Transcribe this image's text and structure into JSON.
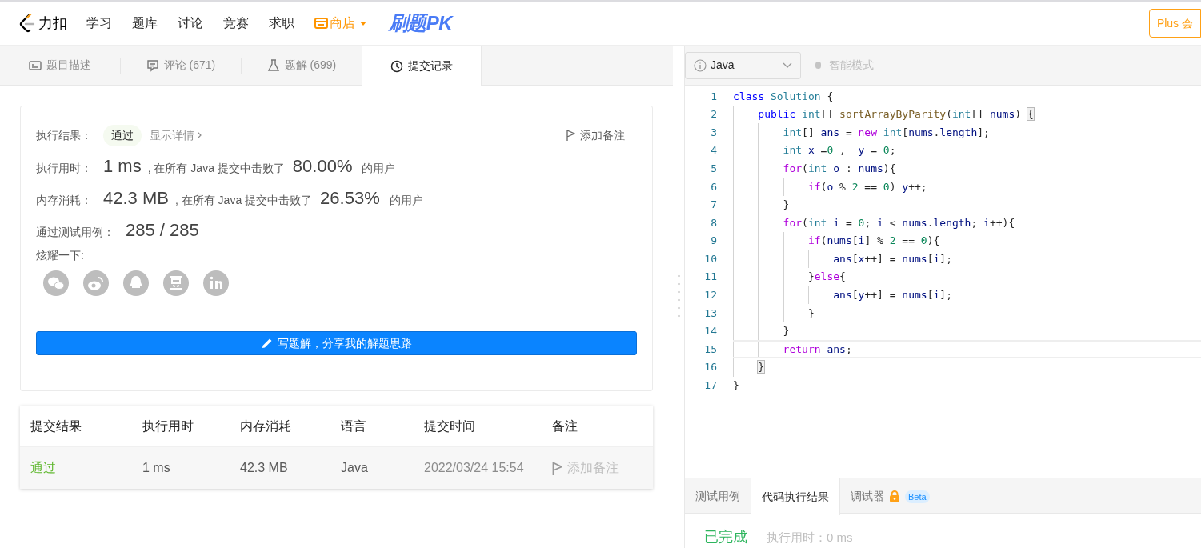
{
  "nav": {
    "logo_text": "力扣",
    "items": [
      {
        "label": "学习",
        "kind": "link"
      },
      {
        "label": "题库",
        "kind": "link"
      },
      {
        "label": "讨论",
        "kind": "link"
      },
      {
        "label": "竞赛",
        "kind": "link"
      },
      {
        "label": "求职",
        "kind": "link"
      },
      {
        "label": "商店",
        "kind": "store"
      }
    ],
    "promo": "刷题PK",
    "plus_button": "Plus 会"
  },
  "tabs": [
    {
      "label": "题目描述",
      "kind": "description",
      "selected": false
    },
    {
      "label": "评论",
      "count": "(671)",
      "kind": "comments",
      "selected": false
    },
    {
      "label": "题解",
      "count": "(699)",
      "kind": "solutions",
      "selected": false
    },
    {
      "label": "提交记录",
      "kind": "submissions",
      "selected": true
    }
  ],
  "result": {
    "status_label": "执行结果：",
    "status": "通过",
    "details_link": "显示详情",
    "note_button": "添加备注",
    "runtime": {
      "label": "执行用时：",
      "value": "1 ms",
      "middle": ", 在所有 Java 提交中击败了",
      "percent": "80.00%",
      "suffix": "的用户"
    },
    "memory": {
      "label": "内存消耗：",
      "value": "42.3 MB",
      "middle": ", 在所有 Java 提交中击败了",
      "percent": "26.53%",
      "suffix": "的用户"
    },
    "tests": {
      "label": "通过测试用例：",
      "value": "285 / 285"
    },
    "share_label": "炫耀一下:",
    "share": [
      {
        "kind": "wechat"
      },
      {
        "kind": "weibo"
      },
      {
        "kind": "qq"
      },
      {
        "kind": "douban"
      },
      {
        "kind": "linkedin"
      }
    ],
    "write_button": "写题解，分享我的解题思路"
  },
  "table": {
    "columns": [
      "提交结果",
      "执行用时",
      "内存消耗",
      "语言",
      "提交时间",
      "备注"
    ],
    "rows": [
      {
        "status": "通过",
        "runtime": "1 ms",
        "memory": "42.3 MB",
        "language": "Java",
        "time": "2022/03/24 15:54",
        "note": "添加备注"
      }
    ]
  },
  "editor": {
    "language": "Java",
    "smart_mode": "智能模式",
    "smart_mode_on": false,
    "lines": [
      {
        "number": "1",
        "current": false,
        "tokens": [
          {
            "text": "class",
            "kind": "kw"
          },
          {
            "text": " Solution",
            "kind": "type"
          },
          {
            "text": " {",
            "kind": "plain"
          }
        ]
      },
      {
        "number": "2",
        "current": false,
        "tokens": [
          {
            "text": "    public",
            "kind": "kw"
          },
          {
            "text": " int",
            "kind": "type"
          },
          {
            "text": "[] ",
            "kind": "plain"
          },
          {
            "text": "sortArrayByParity",
            "kind": "fn"
          },
          {
            "text": "(",
            "kind": "plain"
          },
          {
            "text": "int",
            "kind": "type"
          },
          {
            "text": "[] ",
            "kind": "plain"
          },
          {
            "text": "nums",
            "kind": "var"
          },
          {
            "text": ") ",
            "kind": "plain"
          },
          {
            "text": "{",
            "kind": "match"
          }
        ]
      },
      {
        "number": "3",
        "current": false,
        "tokens": [
          {
            "text": "        int",
            "kind": "type"
          },
          {
            "text": "[] ",
            "kind": "plain"
          },
          {
            "text": "ans",
            "kind": "var"
          },
          {
            "text": " = ",
            "kind": "plain"
          },
          {
            "text": "new",
            "kind": "ctl"
          },
          {
            "text": " int",
            "kind": "type"
          },
          {
            "text": "[",
            "kind": "plain"
          },
          {
            "text": "nums",
            "kind": "var"
          },
          {
            "text": ".",
            "kind": "plain"
          },
          {
            "text": "length",
            "kind": "var"
          },
          {
            "text": "];",
            "kind": "plain"
          }
        ]
      },
      {
        "number": "4",
        "current": false,
        "tokens": [
          {
            "text": "        int",
            "kind": "type"
          },
          {
            "text": " x",
            "kind": "var"
          },
          {
            "text": " =",
            "kind": "plain"
          },
          {
            "text": "0",
            "kind": "num"
          },
          {
            "text": " ,  ",
            "kind": "plain"
          },
          {
            "text": "y",
            "kind": "var"
          },
          {
            "text": " = ",
            "kind": "plain"
          },
          {
            "text": "0",
            "kind": "num"
          },
          {
            "text": ";",
            "kind": "plain"
          }
        ]
      },
      {
        "number": "5",
        "current": false,
        "tokens": [
          {
            "text": "        for",
            "kind": "ctl"
          },
          {
            "text": "(",
            "kind": "plain"
          },
          {
            "text": "int",
            "kind": "type"
          },
          {
            "text": " o",
            "kind": "var"
          },
          {
            "text": " : ",
            "kind": "plain"
          },
          {
            "text": "nums",
            "kind": "var"
          },
          {
            "text": "){",
            "kind": "plain"
          }
        ]
      },
      {
        "number": "6",
        "current": false,
        "tokens": [
          {
            "text": "            if",
            "kind": "ctl"
          },
          {
            "text": "(",
            "kind": "plain"
          },
          {
            "text": "o",
            "kind": "var"
          },
          {
            "text": " % ",
            "kind": "plain"
          },
          {
            "text": "2",
            "kind": "num"
          },
          {
            "text": " == ",
            "kind": "plain"
          },
          {
            "text": "0",
            "kind": "num"
          },
          {
            "text": ") ",
            "kind": "plain"
          },
          {
            "text": "y",
            "kind": "var"
          },
          {
            "text": "++;",
            "kind": "plain"
          }
        ]
      },
      {
        "number": "7",
        "current": false,
        "tokens": [
          {
            "text": "        }",
            "kind": "plain"
          }
        ]
      },
      {
        "number": "8",
        "current": false,
        "tokens": [
          {
            "text": "        for",
            "kind": "ctl"
          },
          {
            "text": "(",
            "kind": "plain"
          },
          {
            "text": "int",
            "kind": "type"
          },
          {
            "text": " i",
            "kind": "var"
          },
          {
            "text": " = ",
            "kind": "plain"
          },
          {
            "text": "0",
            "kind": "num"
          },
          {
            "text": "; ",
            "kind": "plain"
          },
          {
            "text": "i",
            "kind": "var"
          },
          {
            "text": " < ",
            "kind": "plain"
          },
          {
            "text": "nums",
            "kind": "var"
          },
          {
            "text": ".",
            "kind": "plain"
          },
          {
            "text": "length",
            "kind": "var"
          },
          {
            "text": "; ",
            "kind": "plain"
          },
          {
            "text": "i",
            "kind": "var"
          },
          {
            "text": "++){",
            "kind": "plain"
          }
        ]
      },
      {
        "number": "9",
        "current": false,
        "tokens": [
          {
            "text": "            if",
            "kind": "ctl"
          },
          {
            "text": "(",
            "kind": "plain"
          },
          {
            "text": "nums",
            "kind": "var"
          },
          {
            "text": "[",
            "kind": "plain"
          },
          {
            "text": "i",
            "kind": "var"
          },
          {
            "text": "] % ",
            "kind": "plain"
          },
          {
            "text": "2",
            "kind": "num"
          },
          {
            "text": " == ",
            "kind": "plain"
          },
          {
            "text": "0",
            "kind": "num"
          },
          {
            "text": "){",
            "kind": "plain"
          }
        ]
      },
      {
        "number": "10",
        "current": false,
        "tokens": [
          {
            "text": "                ans",
            "kind": "var"
          },
          {
            "text": "[",
            "kind": "plain"
          },
          {
            "text": "x",
            "kind": "var"
          },
          {
            "text": "++] = ",
            "kind": "plain"
          },
          {
            "text": "nums",
            "kind": "var"
          },
          {
            "text": "[",
            "kind": "plain"
          },
          {
            "text": "i",
            "kind": "var"
          },
          {
            "text": "];",
            "kind": "plain"
          }
        ]
      },
      {
        "number": "11",
        "current": false,
        "tokens": [
          {
            "text": "            }",
            "kind": "plain"
          },
          {
            "text": "else",
            "kind": "ctl"
          },
          {
            "text": "{",
            "kind": "plain"
          }
        ]
      },
      {
        "number": "12",
        "current": false,
        "tokens": [
          {
            "text": "                ans",
            "kind": "var"
          },
          {
            "text": "[",
            "kind": "plain"
          },
          {
            "text": "y",
            "kind": "var"
          },
          {
            "text": "++] = ",
            "kind": "plain"
          },
          {
            "text": "nums",
            "kind": "var"
          },
          {
            "text": "[",
            "kind": "plain"
          },
          {
            "text": "i",
            "kind": "var"
          },
          {
            "text": "];",
            "kind": "plain"
          }
        ]
      },
      {
        "number": "13",
        "current": false,
        "tokens": [
          {
            "text": "            }",
            "kind": "plain"
          }
        ]
      },
      {
        "number": "14",
        "current": false,
        "tokens": [
          {
            "text": "        }",
            "kind": "plain"
          }
        ]
      },
      {
        "number": "15",
        "current": true,
        "tokens": [
          {
            "text": "        return",
            "kind": "ctl"
          },
          {
            "text": " ans",
            "kind": "var"
          },
          {
            "text": ";",
            "kind": "plain"
          }
        ]
      },
      {
        "number": "16",
        "current": false,
        "tokens": [
          {
            "text": "    }",
            "kind": "match"
          }
        ]
      },
      {
        "number": "17",
        "current": false,
        "tokens": [
          {
            "text": "}",
            "kind": "plain"
          }
        ]
      }
    ]
  },
  "console": {
    "tabs": [
      {
        "label": "测试用例",
        "selected": false,
        "locked": false
      },
      {
        "label": "代码执行结果",
        "selected": true,
        "locked": false
      },
      {
        "label": "调试器",
        "selected": false,
        "locked": true,
        "badge": "Beta"
      }
    ],
    "status": "已完成",
    "runtime": "执行用时：0 ms"
  }
}
